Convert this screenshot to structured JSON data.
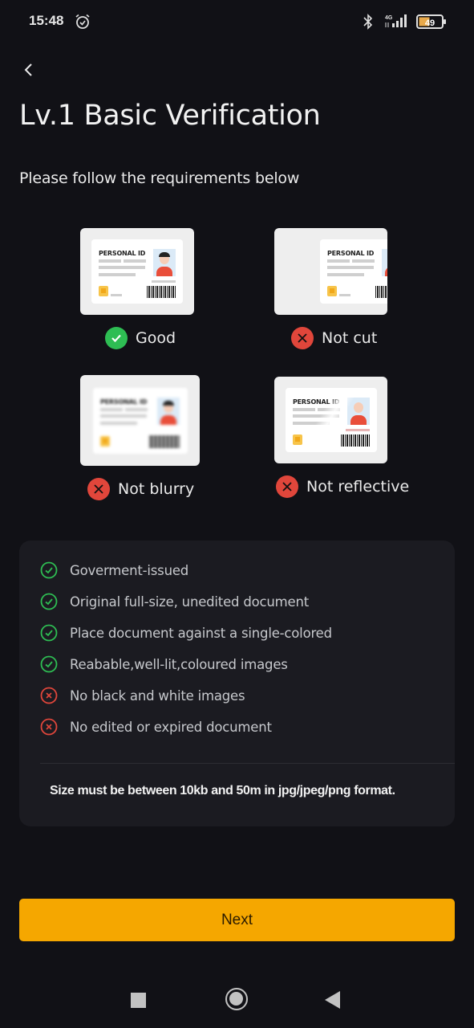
{
  "status_bar": {
    "time": "15:48",
    "network": "4G",
    "battery": "49",
    "icons": [
      "alarm-icon",
      "bluetooth-icon",
      "signal-icon",
      "battery-icon"
    ]
  },
  "header": {
    "back_icon": "chevron-left-icon",
    "title": "Lv.1 Basic Verification",
    "subtitle": "Please follow the requirements below"
  },
  "examples": [
    {
      "label": "Good",
      "status": "good",
      "card_text": "PERSONAL ID"
    },
    {
      "label": "Not cut",
      "status": "bad",
      "card_text": "PERSONAL ID"
    },
    {
      "label": "Not blurry",
      "status": "bad",
      "card_text": "PERSONAL ID"
    },
    {
      "label": "Not reflective",
      "status": "bad",
      "card_text": "PERSONAL ID"
    }
  ],
  "requirements": [
    {
      "text": "Goverment-issued",
      "type": "allowed"
    },
    {
      "text": "Original full-size, unedited document",
      "type": "allowed"
    },
    {
      "text": "Place document against a single-colored",
      "type": "allowed"
    },
    {
      "text": "Reabable,well-lit,coloured images",
      "type": "allowed"
    },
    {
      "text": "No black and white images",
      "type": "disallowed"
    },
    {
      "text": "No edited or expired document",
      "type": "disallowed"
    }
  ],
  "size_note": "Size must be between 10kb and 50m in jpg/jpeg/png format.",
  "next_button": {
    "label": "Next"
  },
  "colors": {
    "accent": "#f5a700",
    "good": "#2ebd53",
    "bad": "#e0463b",
    "background": "#111116",
    "panel": "#1b1b21"
  },
  "nav_bar": [
    "recents-icon",
    "home-icon",
    "back-icon"
  ]
}
